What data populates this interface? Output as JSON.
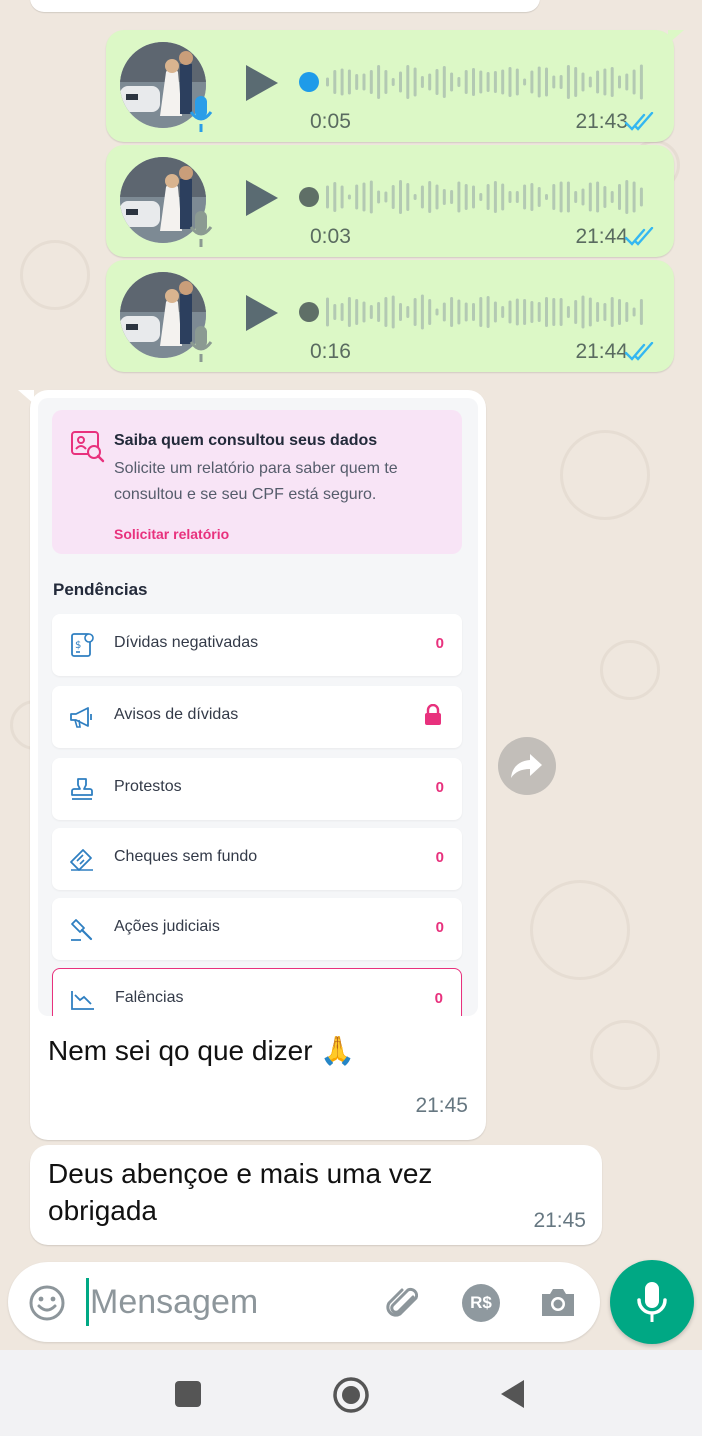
{
  "voice_messages": [
    {
      "duration": "0:05",
      "time": "21:43",
      "mic_color": "#2a9de8",
      "progress": 0
    },
    {
      "duration": "0:03",
      "time": "21:44",
      "mic_color": "#8b9a92",
      "progress": 0
    },
    {
      "duration": "0:16",
      "time": "21:44",
      "mic_color": "#8b9a92",
      "progress": 0
    }
  ],
  "card": {
    "consult_title": "Saiba quem consultou seus dados",
    "consult_desc": "Solicite um relatório para saber quem te consultou e se seu CPF está seguro.",
    "consult_link": "Solicitar relatório",
    "pending_title": "Pendências",
    "rows": [
      {
        "label": "Dívidas negativadas",
        "count": "0"
      },
      {
        "label": "Avisos de dívidas",
        "count": ""
      },
      {
        "label": "Protestos",
        "count": "0"
      },
      {
        "label": "Cheques sem fundo",
        "count": "0"
      },
      {
        "label": "Ações judiciais",
        "count": "0"
      },
      {
        "label": "Falências",
        "count": "0"
      }
    ],
    "caption": "Nem sei qo que dizer 🙏",
    "time": "21:45"
  },
  "message2": {
    "text": "Deus abençoe e mais uma vez obrigada",
    "time": "21:45"
  },
  "composer": {
    "placeholder": "Mensagem",
    "currency_label": "R$"
  },
  "colors": {
    "accent": "#00a884",
    "bubble_out": "#dcf8c6",
    "pink": "#e8317d",
    "read_ticks": "#34b7f1"
  }
}
